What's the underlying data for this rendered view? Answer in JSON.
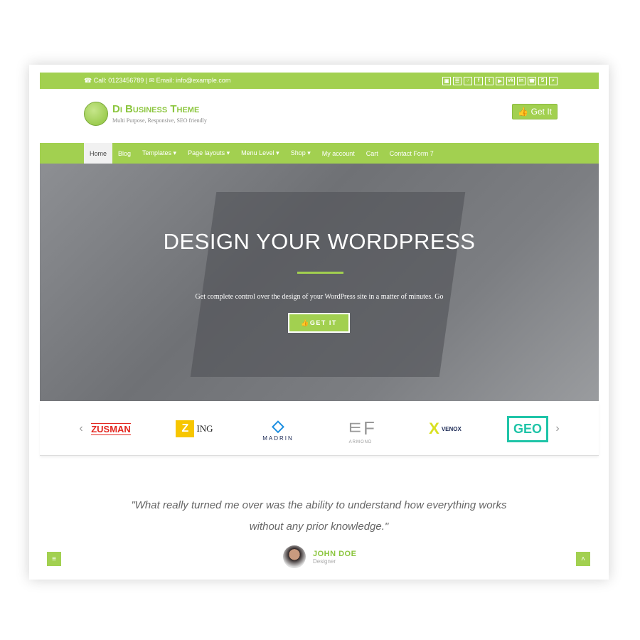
{
  "topbar": {
    "contact": "☎ Call: 0123456789 | ✉ Email: info@example.com",
    "icons": [
      "bag-icon",
      "cart-icon",
      "user-icon",
      "facebook-icon",
      "twitter-icon",
      "youtube-icon",
      "vk-icon",
      "linkedin-icon",
      "whatsapp-icon",
      "skype-icon",
      "search-icon"
    ],
    "glyphs": [
      "▣",
      "☰",
      "♂",
      "f",
      "t",
      "▶",
      "vk",
      "in",
      "☎",
      "S",
      "⌕"
    ]
  },
  "header": {
    "title": "Di Business Theme",
    "tagline": "Multi Purpose, Responsive, SEO friendly",
    "cta": "👍 Get It"
  },
  "nav": {
    "items": [
      "Home",
      "Blog",
      "Templates ▾",
      "Page layouts ▾",
      "Menu Level ▾",
      "Shop ▾",
      "My account",
      "Cart",
      "Contact Form 7"
    ]
  },
  "hero": {
    "title": "DESIGN YOUR WORDPRESS",
    "subtitle": "Get complete control over the design of your WordPress site in a matter of minutes. Go",
    "button": "👍GET IT"
  },
  "logos": {
    "prev": "‹",
    "next": "›",
    "items": [
      "ZUSMAN",
      "ING",
      "MADRIN",
      "ARMOND",
      "VENOX",
      "GEO"
    ]
  },
  "testimonial": {
    "quote_line1": "\"What really turned me over was the ability to understand how everything works",
    "quote_line2": "without any prior knowledge.\"",
    "name": "JOHN DOE",
    "role": "Designer"
  },
  "colors": {
    "accent": "#a2d050"
  },
  "buttons": {
    "menu": "≡",
    "top": "˄"
  }
}
